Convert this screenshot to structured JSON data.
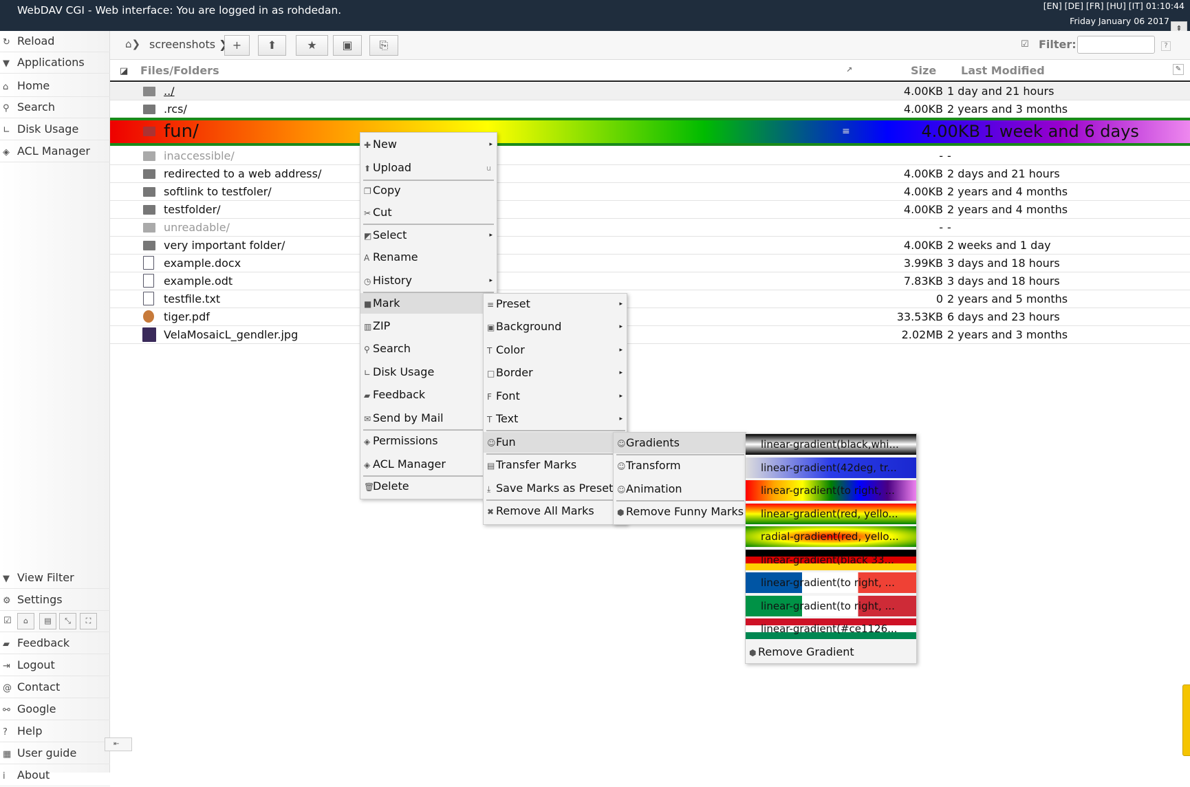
{
  "topbar": {
    "title": "WebDAV CGI - Web interface: You are logged in as rohdedan.",
    "languages": "[EN] [DE] [FR] [HU] [IT] 01:10:44",
    "date": "Friday January 06 2017"
  },
  "sidebar": {
    "top_items": [
      {
        "label": "Reload",
        "icon": "reload-icon"
      },
      {
        "label": "Applications",
        "icon": "applications-icon"
      },
      {
        "label": "Home",
        "icon": "home-icon"
      },
      {
        "label": "Search",
        "icon": "search-icon"
      },
      {
        "label": "Disk Usage",
        "icon": "disk-usage-icon"
      },
      {
        "label": "ACL Manager",
        "icon": "shield-icon"
      }
    ],
    "bottom_items": [
      {
        "label": "View Filter",
        "icon": "filter-icon"
      },
      {
        "label": "Settings",
        "icon": "gear-icon"
      },
      {
        "label": "Feedback",
        "icon": "speech-icon"
      },
      {
        "label": "Logout",
        "icon": "logout-icon"
      },
      {
        "label": "Contact",
        "icon": "at-icon"
      },
      {
        "label": "Google",
        "icon": "link-icon"
      },
      {
        "label": "Help",
        "icon": "help-icon"
      },
      {
        "label": "User guide",
        "icon": "book-icon"
      },
      {
        "label": "About",
        "icon": "info-icon"
      }
    ]
  },
  "toolbar": {
    "crumb": "screenshots",
    "filter_label": "Filter:",
    "filter_value": "",
    "filter_help": "?"
  },
  "table": {
    "col_files": "Files/Folders",
    "col_size": "Size",
    "col_modified": "Last Modified",
    "rows": [
      {
        "name": "../",
        "size": "4.00KB",
        "modified": "1 day and 21 hours",
        "type": "up"
      },
      {
        "name": ".rcs/",
        "size": "4.00KB",
        "modified": "2 years and 3 months",
        "type": "folder"
      },
      {
        "name": "fun/",
        "size": "4.00KB",
        "modified": "1 week and 6 days",
        "type": "folder"
      },
      {
        "name": "inaccessible/",
        "size": "-",
        "modified": "-",
        "type": "folder"
      },
      {
        "name": "redirected to a web address/",
        "size": "4.00KB",
        "modified": "2 days and 21 hours",
        "type": "folder"
      },
      {
        "name": "softlink to testfoler/",
        "size": "4.00KB",
        "modified": "2 years and 4 months",
        "type": "folder"
      },
      {
        "name": "testfolder/",
        "size": "4.00KB",
        "modified": "2 years and 4 months",
        "type": "folder"
      },
      {
        "name": "unreadable/",
        "size": "-",
        "modified": "-",
        "type": "folder"
      },
      {
        "name": "very important folder/",
        "size": "4.00KB",
        "modified": "2 weeks and 1 day",
        "type": "folder"
      },
      {
        "name": "example.docx",
        "size": "3.99KB",
        "modified": "3 days and 18 hours",
        "type": "doc"
      },
      {
        "name": "example.odt",
        "size": "7.83KB",
        "modified": "3 days and 18 hours",
        "type": "doc"
      },
      {
        "name": "testfile.txt",
        "size": "0",
        "modified": "2 years and 5 months",
        "type": "doc"
      },
      {
        "name": "tiger.pdf",
        "size": "33.53KB",
        "modified": "6 days and 23 hours",
        "type": "pdf"
      },
      {
        "name": "VelaMosaicL_gendler.jpg",
        "size": "2.02MB",
        "modified": "2 years and 3 months",
        "type": "jpg"
      }
    ]
  },
  "context_menu": {
    "items": [
      {
        "label": "New",
        "icon": "plus-icon",
        "submenu": true
      },
      {
        "label": "Upload",
        "icon": "upload-icon",
        "shortcut": "u"
      },
      {
        "label": "Copy",
        "icon": "copy-icon"
      },
      {
        "label": "Cut",
        "icon": "scissors-icon"
      },
      {
        "label": "Select",
        "icon": "select-icon",
        "submenu": true
      },
      {
        "label": "Rename",
        "icon": "rename-icon"
      },
      {
        "label": "History",
        "icon": "history-icon",
        "submenu": true
      },
      {
        "label": "Mark",
        "icon": "mark-icon",
        "submenu": false
      },
      {
        "label": "ZIP",
        "icon": "zip-icon"
      },
      {
        "label": "Search",
        "icon": "search-icon"
      },
      {
        "label": "Disk Usage",
        "icon": "disk-usage-icon"
      },
      {
        "label": "Feedback",
        "icon": "speech-icon"
      },
      {
        "label": "Send by Mail",
        "icon": "mail-icon"
      },
      {
        "label": "Permissions",
        "icon": "shield-icon"
      },
      {
        "label": "ACL Manager",
        "icon": "shield-icon"
      },
      {
        "label": "Delete",
        "icon": "trash-icon"
      }
    ]
  },
  "mark_menu": {
    "items": [
      {
        "label": "Preset",
        "icon": "preset-icon"
      },
      {
        "label": "Background",
        "icon": "background-icon"
      },
      {
        "label": "Color",
        "icon": "color-icon"
      },
      {
        "label": "Border",
        "icon": "border-icon"
      },
      {
        "label": "Font",
        "icon": "font-icon"
      },
      {
        "label": "Text",
        "icon": "text-icon"
      },
      {
        "label": "Fun",
        "icon": "smiley-icon"
      },
      {
        "label": "Transfer Marks",
        "icon": "transfer-icon"
      },
      {
        "label": "Save Marks as Preset",
        "icon": "download-icon"
      },
      {
        "label": "Remove All Marks",
        "icon": "remove-icon"
      }
    ]
  },
  "fun_menu": {
    "items": [
      {
        "label": "Gradients",
        "icon": "smiley-icon"
      },
      {
        "label": "Transform",
        "icon": "smiley-icon"
      },
      {
        "label": "Animation",
        "icon": "smiley-icon"
      },
      {
        "label": "Remove Funny Marks",
        "icon": "remove-icon"
      }
    ]
  },
  "gradient_menu": {
    "items": [
      {
        "label": "linear-gradient(black,whi...",
        "bg": "linear-gradient(black,white,black)",
        "color": "#111111"
      },
      {
        "label": "linear-gradient(42deg, tr...",
        "bg": "linear-gradient(to right, #ddd 0%, #2a3ce8 50%, #1a28d0 100%)",
        "color": "#111111"
      },
      {
        "label": "linear-gradient(to right, ...",
        "bg": "linear-gradient(to right, red, orange, yellow, green, blue, indigo, violet)",
        "color": "#111111"
      },
      {
        "label": "linear-gradient(red, yello...",
        "bg": "linear-gradient(red, yellow, green)",
        "color": "#111111"
      },
      {
        "label": "radial-gradient(red, yello...",
        "bg": "radial-gradient(red, yellow, green)",
        "color": "#111111"
      },
      {
        "label": "linear-gradient(black 33...",
        "bg": "linear-gradient(black 33%, #dd0000 33%, #dd0000 66%, #ffce00 66%)",
        "color": "#111111"
      },
      {
        "label": "linear-gradient(to right, ...",
        "bg": "linear-gradient(to right, #0055a4 33%, #ffffff 33%, #ffffff 66%, #ef4135 66%)",
        "color": "#111111"
      },
      {
        "label": "linear-gradient(to right, ...",
        "bg": "linear-gradient(to right, #009246 33%, #ffffff 33%, #ffffff 66%, #ce2b37 66%)",
        "color": "#111111"
      },
      {
        "label": "linear-gradient(#ce1126...",
        "bg": "linear-gradient(#ce1126 33%, #ffffff 33%, #ffffff 66%, #008751 66%)",
        "color": "#111111"
      }
    ],
    "remove_label": "Remove Gradient"
  }
}
